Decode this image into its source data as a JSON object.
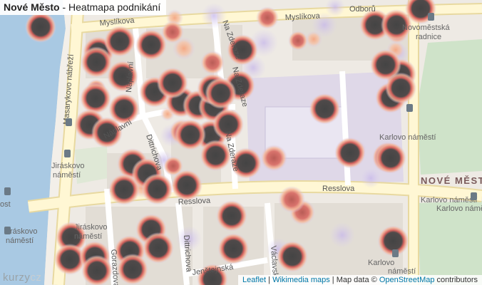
{
  "header": {
    "title_bold": "Nové Město",
    "title_rest": " - Heatmapa podnikání"
  },
  "streets": {
    "myslikova_top": "Myslíkova",
    "myslikova": "Myslíkova",
    "odborу": "Odborů",
    "masarykovo": "Masarykovo nábřeží",
    "naplavni_v": "Náplavní",
    "naplavni_d": "Náplavní",
    "na_zderaze_top": "Na Zderaze",
    "na_zderaze_mid": "Na Zderaze",
    "na_zderaze_low": "Na Zderaze",
    "dittrichova": "Dittrichova",
    "dittrichova_low": "Dittrichova",
    "resslova_left": "Resslova",
    "resslova_right": "Resslova",
    "gorazdova": "Gorazdova",
    "jenstejnska": "Jenštejnská",
    "vaclavska": "Václavská"
  },
  "places": {
    "novomestska": "Novoměstská",
    "radnice": "radnice",
    "karlovo_mid": "Karlovo náměstí",
    "karlovo_r1": "Karlovo náměstí",
    "karlovo_r2": "Karlovo náměstí",
    "karlovo_low": "Karlovo",
    "karlovo_low2": "náměstí",
    "jiraskovo1a": "Jiráskovo",
    "jiraskovo1b": "náměstí",
    "jiraskovo2a": "Jiráskovo",
    "jiraskovo2b": "náměstí",
    "jiraskovo3a": "Jiráskovo",
    "jiraskovo3b": "náměstí",
    "most": "ost",
    "district": "NOVÉ MĚST"
  },
  "attribution": {
    "leaflet": "Leaflet",
    "sep1": " | ",
    "wikimedia": "Wikimedia maps",
    "mid": " | Map data © ",
    "osm": "OpenStreetMap",
    "end": " contributors"
  },
  "logo": {
    "a": "kurzy",
    "b": "cz"
  },
  "colors": {
    "water": "#a9c9e3",
    "park": "#cfe3c9",
    "road": "#fff7d4",
    "heat_core": "#4a4a4a",
    "heat_mid": "#d9736c",
    "heat_low": "#f5b89a",
    "heat_faint": "#cfc2ea"
  },
  "heat_points": [
    {
      "lon": 14.4138,
      "lat": 50.0766,
      "level": "high"
    },
    {
      "lon": 14.4168,
      "lat": 50.0758,
      "level": "high"
    },
    {
      "lon": 14.4187,
      "lat": 50.0754,
      "level": "high"
    },
    {
      "lon": 14.419,
      "lat": 50.0742,
      "level": "high"
    },
    {
      "lon": 14.4175,
      "lat": 50.0738,
      "level": "high"
    },
    {
      "lon": 14.4185,
      "lat": 50.073,
      "level": "high"
    },
    {
      "lon": 14.4197,
      "lat": 50.0727,
      "level": "high"
    },
    {
      "lon": 14.4158,
      "lat": 50.0723,
      "level": "high"
    },
    {
      "lon": 14.4162,
      "lat": 50.0717,
      "level": "high"
    },
    {
      "lon": 14.4192,
      "lat": 50.0694,
      "level": "high"
    },
    {
      "lon": 14.4228,
      "lat": 50.0748,
      "level": "high"
    },
    {
      "lon": 14.4252,
      "lat": 50.0765,
      "level": "high"
    },
    {
      "lon": 14.4258,
      "lat": 50.0756,
      "level": "high"
    },
    {
      "lon": 14.4238,
      "lat": 50.0731,
      "level": "high"
    },
    {
      "lon": 14.4254,
      "lat": 50.0729,
      "level": "high"
    },
    {
      "lon": 14.4255,
      "lat": 50.0697,
      "level": "high"
    },
    {
      "lon": 14.4208,
      "lat": 50.0729,
      "level": "mid"
    },
    {
      "lon": 14.4215,
      "lat": 50.0713,
      "level": "mid"
    }
  ]
}
